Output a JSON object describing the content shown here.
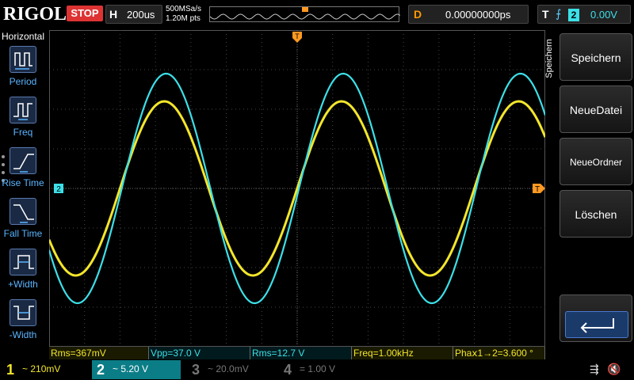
{
  "brand": "RIGOL",
  "run_status": "STOP",
  "horizontal": {
    "label": "H",
    "timebase": "200us",
    "sample_rate": "500MSa/s",
    "memory_depth": "1.20M pts"
  },
  "delay": {
    "label": "D",
    "value": "0.00000000ps"
  },
  "trigger": {
    "label": "T",
    "edge_icon": "rising-edge-icon",
    "source": "2",
    "level": "0.00V"
  },
  "left_menu": {
    "title": "Horizontal",
    "items": [
      {
        "label": "Period",
        "icon": "period-icon"
      },
      {
        "label": "Freq",
        "icon": "freq-icon"
      },
      {
        "label": "Rise Time",
        "icon": "rise-time-icon"
      },
      {
        "label": "Fall Time",
        "icon": "fall-time-icon"
      },
      {
        "label": "+Width",
        "icon": "pos-width-icon"
      },
      {
        "label": "-Width",
        "icon": "neg-width-icon"
      }
    ]
  },
  "right_menu": {
    "tab_label": "Speichern",
    "keys": [
      "Speichern",
      "NeueDatei",
      "NeueOrdner",
      "Löschen"
    ],
    "enter_icon": "enter-icon"
  },
  "markers": {
    "ch2_offset": "2",
    "trigger_level": "T",
    "trigger_position": "T"
  },
  "measurements": [
    {
      "text": "Rms=367mV",
      "channel": 1
    },
    {
      "text": "Vpp=37.0 V",
      "channel": 2
    },
    {
      "text": "Rms=12.7 V",
      "channel": 2
    },
    {
      "text": "Freq=1.00kHz",
      "channel": 1
    },
    {
      "text": "Phaⅹ1→2=3.600 °",
      "channel": 1
    }
  ],
  "channels": [
    {
      "num": "1",
      "coupling": "~",
      "scale": "210mV",
      "state": "on"
    },
    {
      "num": "2",
      "coupling": "~",
      "scale": "5.20 V",
      "state": "on"
    },
    {
      "num": "3",
      "coupling": "~",
      "scale": "20.0mV",
      "state": "off"
    },
    {
      "num": "4",
      "coupling": "=",
      "scale": "1.00 V",
      "state": "off"
    }
  ],
  "status_icons": [
    "usb-icon",
    "mute-icon"
  ],
  "colors": {
    "ch1": "#f3e62b",
    "ch2": "#3ce0e8",
    "trigger_marker": "#ff9922",
    "stop": "#dd3333",
    "menu_label": "#5ab4ff"
  },
  "chart_data": {
    "type": "line",
    "grid": true,
    "divisions": {
      "x": 14,
      "y": 8
    },
    "series": [
      {
        "channel": 1,
        "shape": "sine",
        "frequency_hz": 1000,
        "amplitude_div": 2.2,
        "phase_deg": 3.6
      },
      {
        "channel": 2,
        "shape": "sine",
        "frequency_hz": 1000,
        "amplitude_div": 2.9,
        "phase_deg": 0
      }
    ],
    "time_per_div_s": 0.0002
  }
}
